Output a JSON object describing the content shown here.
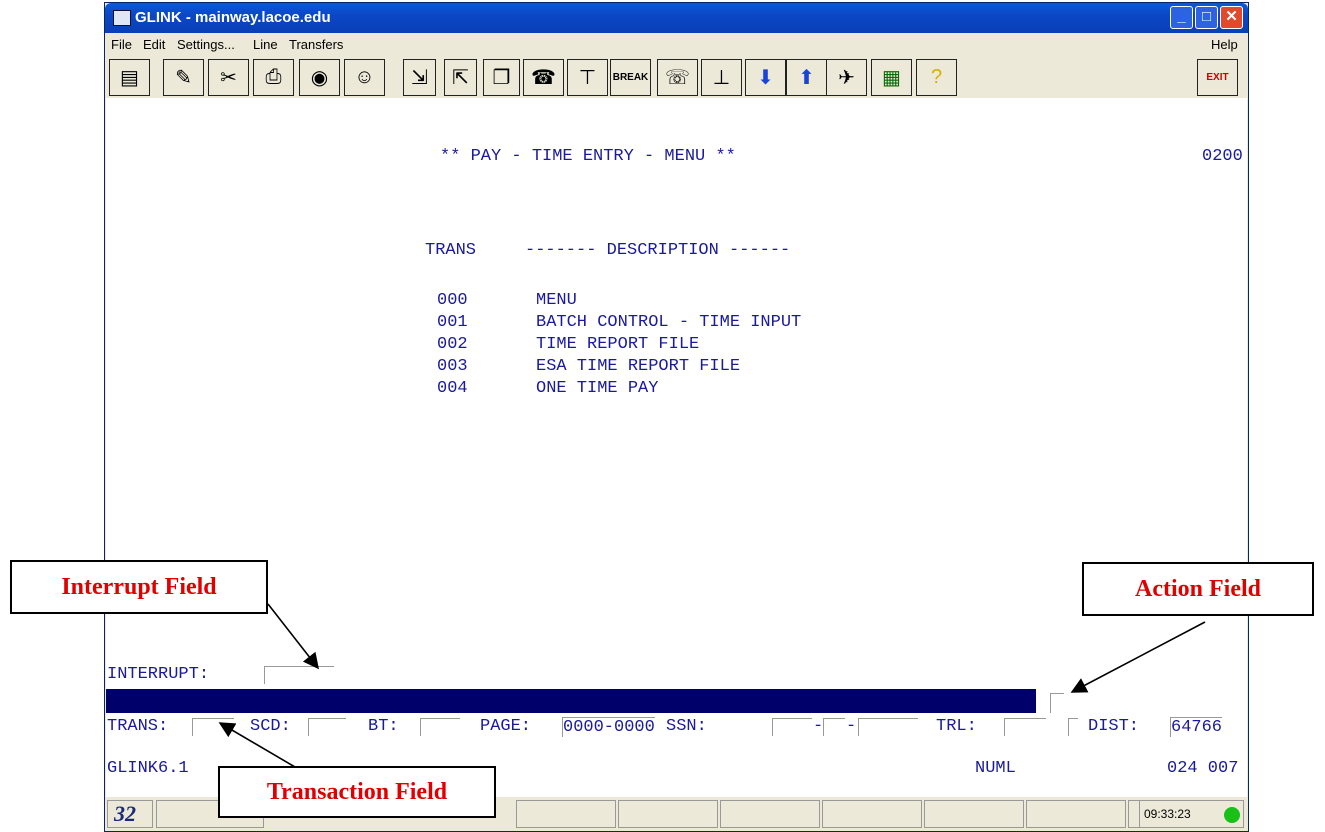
{
  "window": {
    "title": "GLINK - mainway.lacoe.edu"
  },
  "menu": {
    "file": "File",
    "edit": "Edit",
    "settings": "Settings...",
    "line": "Line",
    "transfers": "Transfers",
    "help": "Help"
  },
  "toolbar": {
    "break_label": "BREAK",
    "exit_label": "EXIT"
  },
  "screen": {
    "header": "** PAY - TIME ENTRY - MENU **",
    "screen_id": "0200",
    "col_trans": "TRANS",
    "col_desc": "------- DESCRIPTION ------",
    "rows": [
      {
        "code": "000",
        "desc": "MENU"
      },
      {
        "code": "001",
        "desc": "BATCH CONTROL - TIME INPUT"
      },
      {
        "code": "002",
        "desc": "TIME REPORT FILE"
      },
      {
        "code": "003",
        "desc": "ESA TIME REPORT FILE"
      },
      {
        "code": "004",
        "desc": "ONE TIME PAY"
      }
    ],
    "interrupt_label": "INTERRUPT:",
    "trans_label": "TRANS:",
    "scd_label": "SCD:",
    "bt_label": "BT:",
    "page_label": "PAGE:",
    "page_value": "0000-0000",
    "ssn_label": "SSN:",
    "ssn_sep1": "-",
    "ssn_sep2": "-",
    "trl_label": "TRL:",
    "dist_label": "DIST:",
    "dist_value": "64766",
    "version": "GLINK6.1",
    "numl": "NUML",
    "cursor_pos": "024 007"
  },
  "statusbar": {
    "session": "32",
    "time": "09:33:23"
  },
  "callouts": {
    "interrupt": "Interrupt Field",
    "action": "Action  Field",
    "transaction": "Transaction  Field"
  }
}
